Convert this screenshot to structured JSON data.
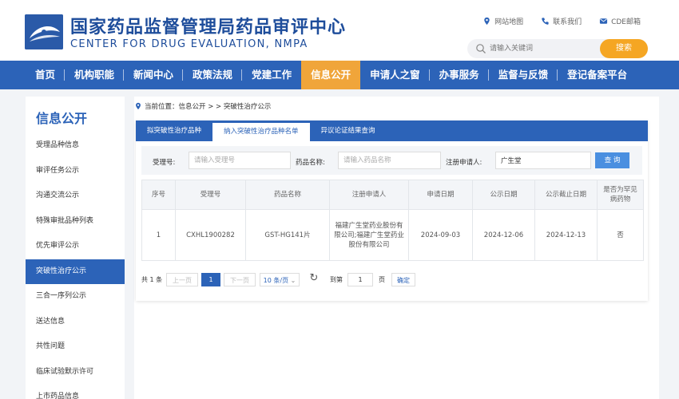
{
  "header": {
    "title_cn": "国家药品监督管理局药品审评中心",
    "title_en": "CENTER FOR DRUG EVALUATION, NMPA",
    "links": [
      "网站地图",
      "联系我们",
      "CDE邮箱"
    ],
    "search_placeholder": "请输入关键词",
    "search_button": "搜索"
  },
  "nav": {
    "items": [
      "首页",
      "机构职能",
      "新闻中心",
      "政策法规",
      "党建工作",
      "信息公开",
      "申请人之窗",
      "办事服务",
      "监督与反馈",
      "登记备案平台"
    ],
    "active": "信息公开"
  },
  "sidebar": {
    "title": "信息公开",
    "items": [
      "受理品种信息",
      "审评任务公示",
      "沟通交流公示",
      "特殊审批品种列表",
      "优先审评公示",
      "突破性治疗公示",
      "三合一序列公示",
      "送达信息",
      "共性问题",
      "临床试验默示许可",
      "上市药品信息"
    ],
    "active": "突破性治疗公示"
  },
  "breadcrumb": "当前位置：信息公开 > > 突破性治疗公示",
  "tabs": [
    "拟突破性治疗品种",
    "纳入突破性治疗品种名单",
    "异议论证结果查询"
  ],
  "filter": {
    "accept_no_label": "受理号:",
    "accept_no_placeholder": "请输入受理号",
    "drug_name_label": "药品名称:",
    "drug_name_placeholder": "请输入药品名称",
    "applicant_label": "注册申请人:",
    "applicant_value": "广生堂",
    "query_button": "查 询"
  },
  "table": {
    "headers": [
      "序号",
      "受理号",
      "药品名称",
      "注册申请人",
      "申请日期",
      "公示日期",
      "公示截止日期",
      "是否为罕见病药物"
    ],
    "rows": [
      [
        "1",
        "CXHL1900282",
        "GST-HG141片",
        "福建广生堂药业股份有限公司;福建广生堂药业股份有限公司",
        "2024-09-03",
        "2024-12-06",
        "2024-12-13",
        "否"
      ]
    ]
  },
  "pager": {
    "total": "共 1 条",
    "prev": "上一页",
    "current": "1",
    "next": "下一页",
    "page_size": "10 条/页",
    "goto_label": "到第",
    "goto_value": "1",
    "page_unit": "页",
    "confirm": "确定"
  },
  "colors": {
    "primary": "#2c63b8",
    "accent": "#f0a53a",
    "search_button": "#f5a623",
    "query_button": "#4a8fe0"
  }
}
